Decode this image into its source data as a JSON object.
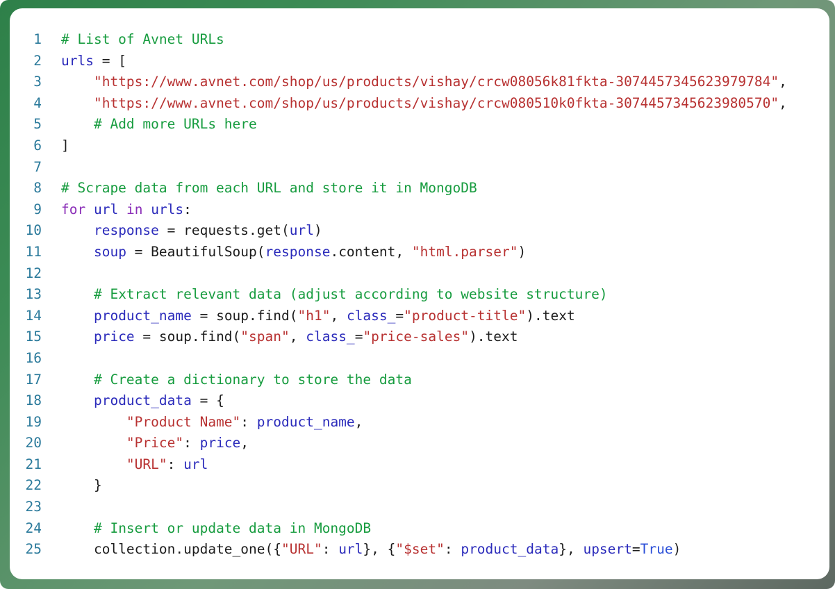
{
  "card": {
    "frame_color_start": "#2e8049",
    "frame_color_end": "#5d6861",
    "surface_color": "#ffffff"
  },
  "colors": {
    "line_number": "#2b7a9b",
    "comment": "#179c3f",
    "string": "#b83232",
    "keyword": "#8b2fb8",
    "name": "#2b2bbb",
    "boolean": "#2b4fd8",
    "plain": "#1c1c1c"
  },
  "code": {
    "language": "python",
    "first_line_number": 1,
    "total_lines": 25,
    "lines": [
      {
        "n": "1",
        "tokens": [
          {
            "t": "# List of Avnet URLs",
            "c": "com"
          }
        ]
      },
      {
        "n": "2",
        "tokens": [
          {
            "t": "urls",
            "c": "nam"
          },
          {
            "t": " = [",
            "c": "pln"
          }
        ]
      },
      {
        "n": "3",
        "tokens": [
          {
            "t": "    ",
            "c": "pln"
          },
          {
            "t": "\"https://www.avnet.com/shop/us/products/vishay/crcw08056k81fkta-3074457345623979784\"",
            "c": "str"
          },
          {
            "t": ",",
            "c": "pln"
          }
        ]
      },
      {
        "n": "4",
        "tokens": [
          {
            "t": "    ",
            "c": "pln"
          },
          {
            "t": "\"https://www.avnet.com/shop/us/products/vishay/crcw080510k0fkta-3074457345623980570\"",
            "c": "str"
          },
          {
            "t": ",",
            "c": "pln"
          }
        ]
      },
      {
        "n": "5",
        "tokens": [
          {
            "t": "    ",
            "c": "pln"
          },
          {
            "t": "# Add more URLs here",
            "c": "com"
          }
        ]
      },
      {
        "n": "6",
        "tokens": [
          {
            "t": "]",
            "c": "pln"
          }
        ]
      },
      {
        "n": "7",
        "tokens": [
          {
            "t": "",
            "c": "pln"
          }
        ]
      },
      {
        "n": "8",
        "tokens": [
          {
            "t": "# Scrape data from each URL and store it in MongoDB",
            "c": "com"
          }
        ]
      },
      {
        "n": "9",
        "tokens": [
          {
            "t": "for",
            "c": "kw"
          },
          {
            "t": " ",
            "c": "pln"
          },
          {
            "t": "url",
            "c": "nam"
          },
          {
            "t": " ",
            "c": "pln"
          },
          {
            "t": "in",
            "c": "kw"
          },
          {
            "t": " ",
            "c": "pln"
          },
          {
            "t": "urls",
            "c": "nam"
          },
          {
            "t": ":",
            "c": "pln"
          }
        ]
      },
      {
        "n": "10",
        "tokens": [
          {
            "t": "    ",
            "c": "pln"
          },
          {
            "t": "response",
            "c": "nam"
          },
          {
            "t": " = requests.get(",
            "c": "pln"
          },
          {
            "t": "url",
            "c": "nam"
          },
          {
            "t": ")",
            "c": "pln"
          }
        ]
      },
      {
        "n": "11",
        "tokens": [
          {
            "t": "    ",
            "c": "pln"
          },
          {
            "t": "soup",
            "c": "nam"
          },
          {
            "t": " = BeautifulSoup(",
            "c": "pln"
          },
          {
            "t": "response",
            "c": "nam"
          },
          {
            "t": ".content, ",
            "c": "pln"
          },
          {
            "t": "\"html.parser\"",
            "c": "str"
          },
          {
            "t": ")",
            "c": "pln"
          }
        ]
      },
      {
        "n": "12",
        "tokens": [
          {
            "t": "",
            "c": "pln"
          }
        ]
      },
      {
        "n": "13",
        "tokens": [
          {
            "t": "    ",
            "c": "pln"
          },
          {
            "t": "# Extract relevant data (adjust according to website structure)",
            "c": "com"
          }
        ]
      },
      {
        "n": "14",
        "tokens": [
          {
            "t": "    ",
            "c": "pln"
          },
          {
            "t": "product_name",
            "c": "nam"
          },
          {
            "t": " = soup.find(",
            "c": "pln"
          },
          {
            "t": "\"h1\"",
            "c": "str"
          },
          {
            "t": ", ",
            "c": "pln"
          },
          {
            "t": "class_",
            "c": "nam"
          },
          {
            "t": "=",
            "c": "pln"
          },
          {
            "t": "\"product-title\"",
            "c": "str"
          },
          {
            "t": ").text",
            "c": "pln"
          }
        ]
      },
      {
        "n": "15",
        "tokens": [
          {
            "t": "    ",
            "c": "pln"
          },
          {
            "t": "price",
            "c": "nam"
          },
          {
            "t": " = soup.find(",
            "c": "pln"
          },
          {
            "t": "\"span\"",
            "c": "str"
          },
          {
            "t": ", ",
            "c": "pln"
          },
          {
            "t": "class_",
            "c": "nam"
          },
          {
            "t": "=",
            "c": "pln"
          },
          {
            "t": "\"price-sales\"",
            "c": "str"
          },
          {
            "t": ").text",
            "c": "pln"
          }
        ]
      },
      {
        "n": "16",
        "tokens": [
          {
            "t": "",
            "c": "pln"
          }
        ]
      },
      {
        "n": "17",
        "tokens": [
          {
            "t": "    ",
            "c": "pln"
          },
          {
            "t": "# Create a dictionary to store the data",
            "c": "com"
          }
        ]
      },
      {
        "n": "18",
        "tokens": [
          {
            "t": "    ",
            "c": "pln"
          },
          {
            "t": "product_data",
            "c": "nam"
          },
          {
            "t": " = {",
            "c": "pln"
          }
        ]
      },
      {
        "n": "19",
        "tokens": [
          {
            "t": "        ",
            "c": "pln"
          },
          {
            "t": "\"Product Name\"",
            "c": "str"
          },
          {
            "t": ": ",
            "c": "pln"
          },
          {
            "t": "product_name",
            "c": "nam"
          },
          {
            "t": ",",
            "c": "pln"
          }
        ]
      },
      {
        "n": "20",
        "tokens": [
          {
            "t": "        ",
            "c": "pln"
          },
          {
            "t": "\"Price\"",
            "c": "str"
          },
          {
            "t": ": ",
            "c": "pln"
          },
          {
            "t": "price",
            "c": "nam"
          },
          {
            "t": ",",
            "c": "pln"
          }
        ]
      },
      {
        "n": "21",
        "tokens": [
          {
            "t": "        ",
            "c": "pln"
          },
          {
            "t": "\"URL\"",
            "c": "str"
          },
          {
            "t": ": ",
            "c": "pln"
          },
          {
            "t": "url",
            "c": "nam"
          }
        ]
      },
      {
        "n": "22",
        "tokens": [
          {
            "t": "    }",
            "c": "pln"
          }
        ]
      },
      {
        "n": "23",
        "tokens": [
          {
            "t": "",
            "c": "pln"
          }
        ]
      },
      {
        "n": "24",
        "tokens": [
          {
            "t": "    ",
            "c": "pln"
          },
          {
            "t": "# Insert or update data in MongoDB",
            "c": "com"
          }
        ]
      },
      {
        "n": "25",
        "tokens": [
          {
            "t": "    ",
            "c": "pln"
          },
          {
            "t": "collection.update_one({",
            "c": "pln"
          },
          {
            "t": "\"URL\"",
            "c": "str"
          },
          {
            "t": ": ",
            "c": "pln"
          },
          {
            "t": "url",
            "c": "nam"
          },
          {
            "t": "}, {",
            "c": "pln"
          },
          {
            "t": "\"$set\"",
            "c": "str"
          },
          {
            "t": ": ",
            "c": "pln"
          },
          {
            "t": "product_data",
            "c": "nam"
          },
          {
            "t": "}, ",
            "c": "pln"
          },
          {
            "t": "upsert",
            "c": "nam"
          },
          {
            "t": "=",
            "c": "pln"
          },
          {
            "t": "True",
            "c": "bln"
          },
          {
            "t": ")",
            "c": "pln"
          }
        ]
      }
    ]
  }
}
